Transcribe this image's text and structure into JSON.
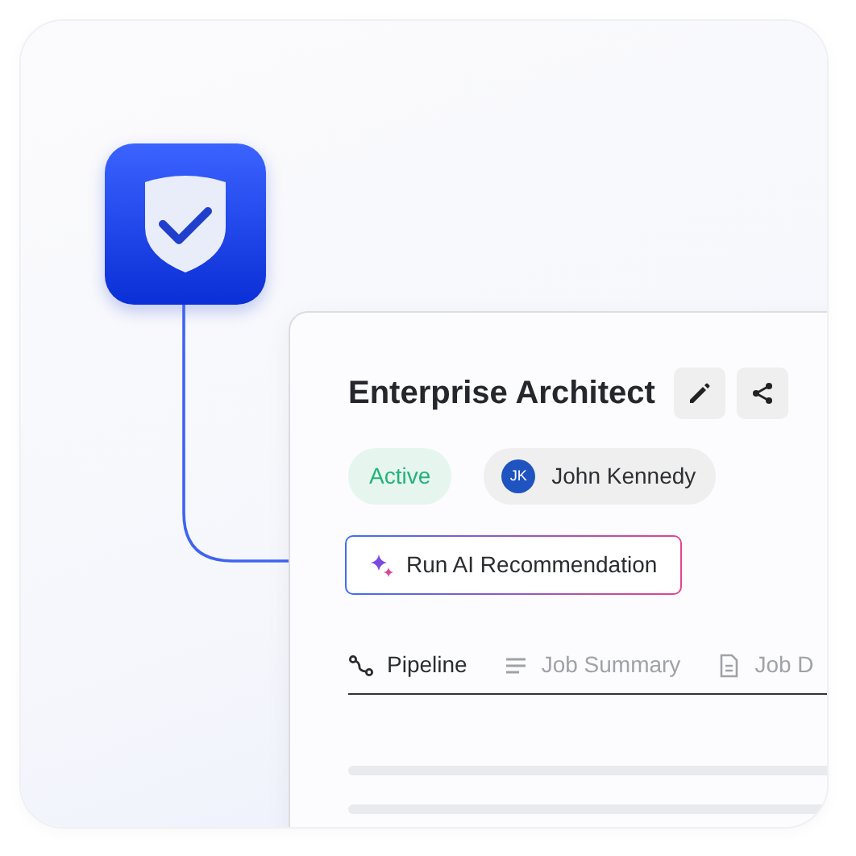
{
  "job": {
    "title": "Enterprise Architect",
    "actions": [
      {
        "kind": "edit"
      },
      {
        "kind": "share"
      }
    ],
    "status": "Active",
    "owner": {
      "initials": "JK",
      "name": "John Kennedy"
    },
    "ai_button": "Run AI Recommendation",
    "tabs": [
      {
        "kind": "pipeline",
        "label": "Pipeline",
        "selected": true
      },
      {
        "kind": "summary",
        "label": "Job Summary",
        "selected": false
      },
      {
        "kind": "document",
        "label": "Job D",
        "selected": false
      }
    ]
  }
}
